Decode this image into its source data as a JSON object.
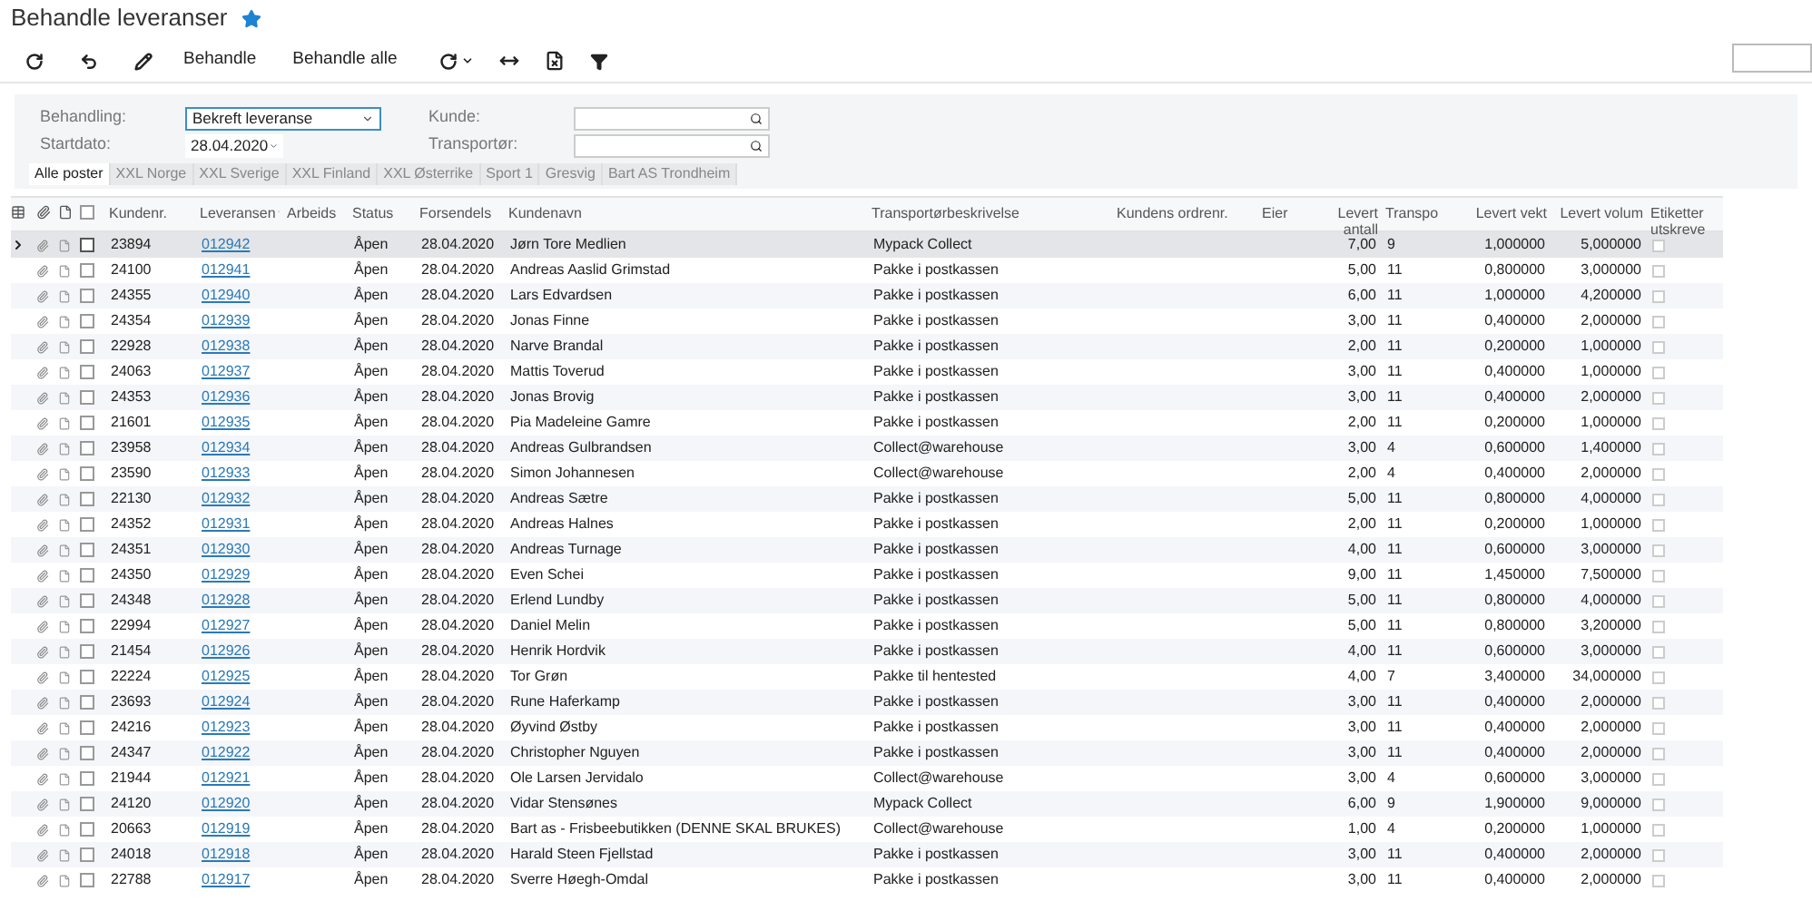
{
  "title": "Behandle leveranser",
  "favorite": true,
  "toolbar": {
    "buttons": [
      "Behandle",
      "Behandle alle"
    ]
  },
  "filters": {
    "behandling": {
      "label": "Behandling:",
      "value": "Bekreft leveranse"
    },
    "startdato": {
      "label": "Startdato:",
      "value": "28.04.2020"
    },
    "kunde": {
      "label": "Kunde:"
    },
    "transportor": {
      "label": "Transportør:"
    }
  },
  "tabs": [
    {
      "label": "Alle poster",
      "selected": true
    },
    {
      "label": "XXL Norge",
      "selected": false
    },
    {
      "label": "XXL Sverige",
      "selected": false
    },
    {
      "label": "XXL Finland",
      "selected": false
    },
    {
      "label": "XXL Østerrike",
      "selected": false
    },
    {
      "label": "Sport 1",
      "selected": false
    },
    {
      "label": "Gresvig",
      "selected": false
    },
    {
      "label": "Bart AS Trondheim",
      "selected": false
    }
  ],
  "select_all": {
    "checked": false
  },
  "columns": [
    "Kundenr.",
    "Leveransen",
    "Arbeids",
    "Status",
    "Forsendels",
    "Kundenavn",
    "Transportørbeskrivelse",
    "Kundens ordrenr.",
    "Eier",
    "Levert antall",
    "Transpo",
    "Levert vekt",
    "Levert volum",
    "Etiketter utskreve"
  ],
  "rows": [
    {
      "selected": true,
      "cells": [
        "23894",
        "012942",
        "Åpen",
        "28.04.2020",
        "Jørn Tore Medlien",
        "Mypack Collect",
        "7,00",
        "9",
        "1,000000",
        "5,000000"
      ],
      "printed": false
    },
    {
      "selected": false,
      "cells": [
        "24100",
        "012941",
        "Åpen",
        "28.04.2020",
        "Andreas Aaslid Grimstad",
        "Pakke i postkassen",
        "5,00",
        "11",
        "0,800000",
        "3,000000"
      ],
      "printed": false
    },
    {
      "selected": false,
      "cells": [
        "24355",
        "012940",
        "Åpen",
        "28.04.2020",
        "Lars Edvardsen",
        "Pakke i postkassen",
        "6,00",
        "11",
        "1,000000",
        "4,200000"
      ],
      "printed": false
    },
    {
      "selected": false,
      "cells": [
        "24354",
        "012939",
        "Åpen",
        "28.04.2020",
        "Jonas Finne",
        "Pakke i postkassen",
        "3,00",
        "11",
        "0,400000",
        "2,000000"
      ],
      "printed": false
    },
    {
      "selected": false,
      "cells": [
        "22928",
        "012938",
        "Åpen",
        "28.04.2020",
        "Narve Brandal",
        "Pakke i postkassen",
        "2,00",
        "11",
        "0,200000",
        "1,000000"
      ],
      "printed": false
    },
    {
      "selected": false,
      "cells": [
        "24063",
        "012937",
        "Åpen",
        "28.04.2020",
        "Mattis Toverud",
        "Pakke i postkassen",
        "3,00",
        "11",
        "0,400000",
        "1,000000"
      ],
      "printed": false
    },
    {
      "selected": false,
      "cells": [
        "24353",
        "012936",
        "Åpen",
        "28.04.2020",
        "Jonas Brovig",
        "Pakke i postkassen",
        "3,00",
        "11",
        "0,400000",
        "2,000000"
      ],
      "printed": false
    },
    {
      "selected": false,
      "cells": [
        "21601",
        "012935",
        "Åpen",
        "28.04.2020",
        "Pia Madeleine Gamre",
        "Pakke i postkassen",
        "2,00",
        "11",
        "0,200000",
        "1,000000"
      ],
      "printed": false
    },
    {
      "selected": false,
      "cells": [
        "23958",
        "012934",
        "Åpen",
        "28.04.2020",
        "Andreas Gulbrandsen",
        "Collect@warehouse",
        "3,00",
        "4",
        "0,600000",
        "1,400000"
      ],
      "printed": false
    },
    {
      "selected": false,
      "cells": [
        "23590",
        "012933",
        "Åpen",
        "28.04.2020",
        "Simon Johannesen",
        "Collect@warehouse",
        "2,00",
        "4",
        "0,400000",
        "2,000000"
      ],
      "printed": false
    },
    {
      "selected": false,
      "cells": [
        "22130",
        "012932",
        "Åpen",
        "28.04.2020",
        "Andreas Sætre",
        "Pakke i postkassen",
        "5,00",
        "11",
        "0,800000",
        "4,000000"
      ],
      "printed": false
    },
    {
      "selected": false,
      "cells": [
        "24352",
        "012931",
        "Åpen",
        "28.04.2020",
        "Andreas Halnes",
        "Pakke i postkassen",
        "2,00",
        "11",
        "0,200000",
        "1,000000"
      ],
      "printed": false
    },
    {
      "selected": false,
      "cells": [
        "24351",
        "012930",
        "Åpen",
        "28.04.2020",
        "Andreas Turnage",
        "Pakke i postkassen",
        "4,00",
        "11",
        "0,600000",
        "3,000000"
      ],
      "printed": false
    },
    {
      "selected": false,
      "cells": [
        "24350",
        "012929",
        "Åpen",
        "28.04.2020",
        "Even Schei",
        "Pakke i postkassen",
        "9,00",
        "11",
        "1,450000",
        "7,500000"
      ],
      "printed": false
    },
    {
      "selected": false,
      "cells": [
        "24348",
        "012928",
        "Åpen",
        "28.04.2020",
        "Erlend Lundby",
        "Pakke i postkassen",
        "5,00",
        "11",
        "0,800000",
        "4,000000"
      ],
      "printed": false
    },
    {
      "selected": false,
      "cells": [
        "22994",
        "012927",
        "Åpen",
        "28.04.2020",
        "Daniel Melin",
        "Pakke i postkassen",
        "5,00",
        "11",
        "0,800000",
        "3,200000"
      ],
      "printed": false
    },
    {
      "selected": false,
      "cells": [
        "21454",
        "012926",
        "Åpen",
        "28.04.2020",
        "Henrik Hordvik",
        "Pakke i postkassen",
        "4,00",
        "11",
        "0,600000",
        "3,000000"
      ],
      "printed": false
    },
    {
      "selected": false,
      "cells": [
        "22224",
        "012925",
        "Åpen",
        "28.04.2020",
        "Tor Grøn",
        "Pakke til hentested",
        "4,00",
        "7",
        "3,400000",
        "34,000000"
      ],
      "printed": false
    },
    {
      "selected": false,
      "cells": [
        "23693",
        "012924",
        "Åpen",
        "28.04.2020",
        "Rune Haferkamp",
        "Pakke i postkassen",
        "3,00",
        "11",
        "0,400000",
        "2,000000"
      ],
      "printed": false
    },
    {
      "selected": false,
      "cells": [
        "24216",
        "012923",
        "Åpen",
        "28.04.2020",
        "Øyvind Østby",
        "Pakke i postkassen",
        "3,00",
        "11",
        "0,400000",
        "2,000000"
      ],
      "printed": false
    },
    {
      "selected": false,
      "cells": [
        "24347",
        "012922",
        "Åpen",
        "28.04.2020",
        "Christopher Nguyen",
        "Pakke i postkassen",
        "3,00",
        "11",
        "0,400000",
        "2,000000"
      ],
      "printed": false
    },
    {
      "selected": false,
      "cells": [
        "21944",
        "012921",
        "Åpen",
        "28.04.2020",
        "Ole Larsen Jervidalo",
        "Collect@warehouse",
        "3,00",
        "4",
        "0,600000",
        "3,000000"
      ],
      "printed": false
    },
    {
      "selected": false,
      "cells": [
        "24120",
        "012920",
        "Åpen",
        "28.04.2020",
        "Vidar Stensønes",
        "Mypack Collect",
        "6,00",
        "9",
        "1,900000",
        "9,000000"
      ],
      "printed": false
    },
    {
      "selected": false,
      "cells": [
        "20663",
        "012919",
        "Åpen",
        "28.04.2020",
        "Bart as - Frisbeebutikken (DENNE SKAL BRUKES)",
        "Collect@warehouse",
        "1,00",
        "4",
        "0,200000",
        "1,000000"
      ],
      "printed": false
    },
    {
      "selected": false,
      "cells": [
        "24018",
        "012918",
        "Åpen",
        "28.04.2020",
        "Harald Steen Fjellstad",
        "Pakke i postkassen",
        "3,00",
        "11",
        "0,400000",
        "2,000000"
      ],
      "printed": false
    },
    {
      "selected": false,
      "cells": [
        "22788",
        "012917",
        "Åpen",
        "28.04.2020",
        "Sverre Høegh-Omdal",
        "Pakke i postkassen",
        "3,00",
        "11",
        "0,400000",
        "2,000000"
      ],
      "printed": false
    }
  ]
}
